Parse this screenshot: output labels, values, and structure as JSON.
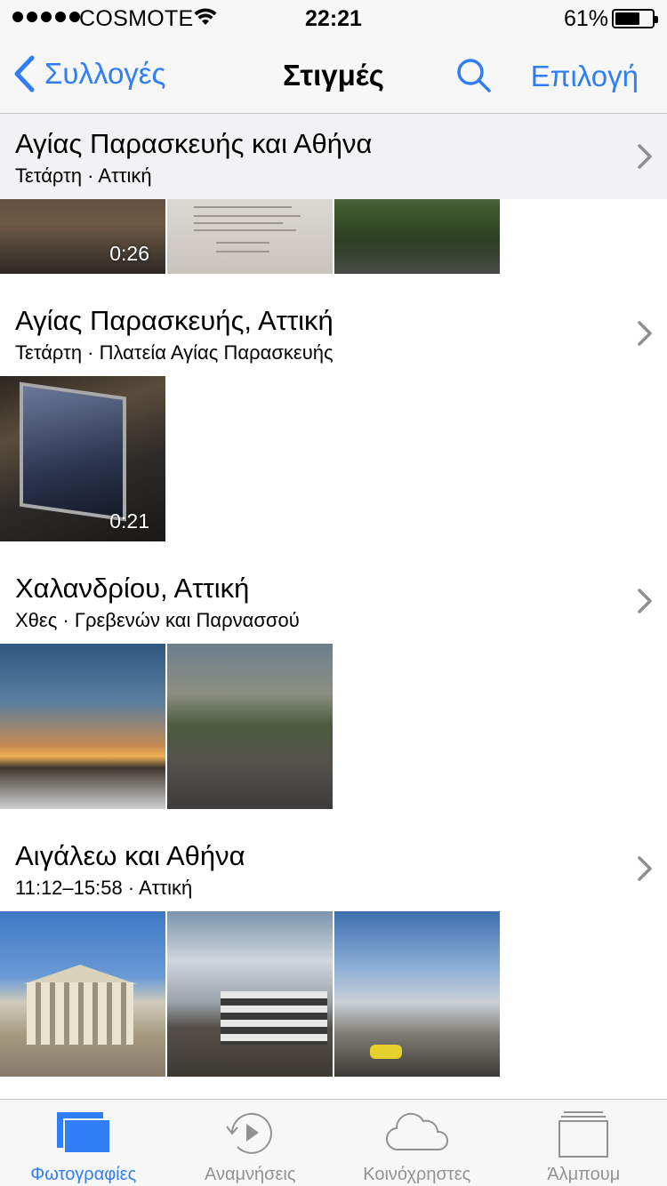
{
  "status_bar": {
    "carrier": "COSMOTE",
    "time": "22:21",
    "battery": "61%",
    "battery_level": 0.61
  },
  "nav": {
    "back_label": "Συλλογές",
    "title": "Στιγμές",
    "select_label": "Επιλογή"
  },
  "moments": [
    {
      "title": "Αγίας Παρασκευής και Αθήνα",
      "subtitle": "Τετάρτη · Αττική",
      "thumbs": [
        {
          "kind": "video",
          "duration": "0:26"
        },
        {
          "kind": "photo"
        },
        {
          "kind": "photo"
        }
      ]
    },
    {
      "title": "Αγίας Παρασκευής, Αττική",
      "subtitle": "Τετάρτη · Πλατεία Αγίας Παρασκευής",
      "thumbs": [
        {
          "kind": "video",
          "duration": "0:21"
        }
      ]
    },
    {
      "title": "Χαλανδρίου, Αττική",
      "subtitle": "Χθες · Γρεβενών και Παρνασσού",
      "thumbs": [
        {
          "kind": "photo"
        },
        {
          "kind": "photo"
        }
      ]
    },
    {
      "title": "Αιγάλεω και Αθήνα",
      "subtitle": "11:12–15:58 · Αττική",
      "thumbs": [
        {
          "kind": "photo"
        },
        {
          "kind": "photo"
        },
        {
          "kind": "photo"
        }
      ]
    }
  ],
  "tabs": [
    {
      "label": "Φωτογραφίες",
      "active": true
    },
    {
      "label": "Αναμνήσεις",
      "active": false
    },
    {
      "label": "Κοινόχρηστες",
      "active": false
    },
    {
      "label": "Άλμπουμ",
      "active": false
    }
  ],
  "colors": {
    "accent": "#2f7ef6",
    "inactive_tab": "#929292"
  }
}
